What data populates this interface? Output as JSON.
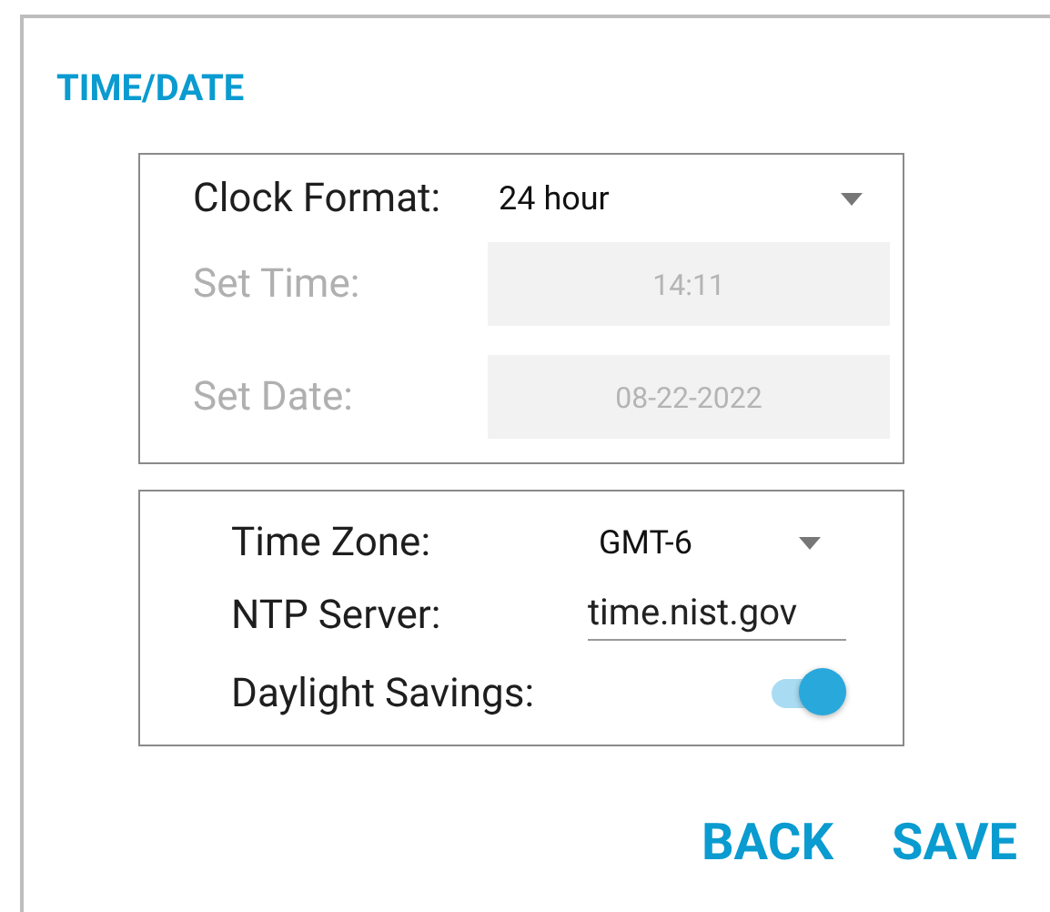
{
  "title": "TIME/DATE",
  "clock_format": {
    "label": "Clock Format:",
    "value": "24 hour"
  },
  "time_fields": [
    {
      "label": "Set Time:",
      "value": "14:11",
      "disabled": true
    },
    {
      "label": "Set Date:",
      "value": "08-22-2022",
      "disabled": true
    }
  ],
  "time_zone": {
    "label": "Time Zone:",
    "value": "GMT-6"
  },
  "ntp_server": {
    "label": "NTP Server:",
    "value": "time.nist.gov"
  },
  "daylight_savings": {
    "label": "Daylight Savings:",
    "on": true
  },
  "buttons": [
    "BACK",
    "SAVE"
  ]
}
